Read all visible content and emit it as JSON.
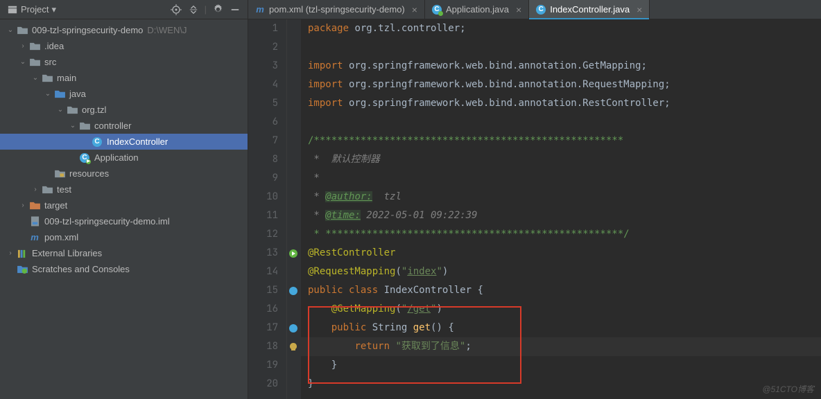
{
  "sidebar": {
    "title": "Project",
    "tree": {
      "root": {
        "label": "009-tzl-springsecurity-demo",
        "hint": "D:\\WEN\\J"
      },
      "idea": ".idea",
      "src": "src",
      "main": "main",
      "java": "java",
      "orgtzl": "org.tzl",
      "controller": "controller",
      "indexcontroller": "IndexController",
      "application": "Application",
      "resources": "resources",
      "test": "test",
      "target": "target",
      "iml": "009-tzl-springsecurity-demo.iml",
      "pom": "pom.xml",
      "extlib": "External Libraries",
      "scratches": "Scratches and Consoles"
    }
  },
  "tabs": [
    {
      "label": "pom.xml (tzl-springsecurity-demo)",
      "icon": "m"
    },
    {
      "label": "Application.java",
      "icon": "c"
    },
    {
      "label": "IndexController.java",
      "icon": "c",
      "active": true
    }
  ],
  "code": {
    "line1": {
      "kw": "package",
      "rest": " org.tzl.controller;"
    },
    "line3": {
      "kw": "import",
      "p1": " org.springframework.web.bind.annotation.",
      "cls": "GetMapping",
      "end": ";"
    },
    "line4": {
      "kw": "import",
      "p1": " org.springframework.web.bind.annotation.",
      "cls": "RequestMapping",
      "end": ";"
    },
    "line5": {
      "kw": "import",
      "p1": " org.springframework.web.bind.annotation.",
      "cls": "RestController",
      "end": ";"
    },
    "line7": "/*****************************************************",
    "line8": " *  默认控制器",
    "line9": " *",
    "line10": {
      "pre": " * ",
      "tag": "@author:",
      "val": "  tzl"
    },
    "line11": {
      "pre": " * ",
      "tag": "@time:",
      "val": " 2022-05-01 09:22:39"
    },
    "line12": " * ***************************************************/",
    "line13": "@RestController",
    "line14": {
      "ann": "@RequestMapping",
      "p": "(",
      "s": "\"",
      "u": "index",
      "s2": "\"",
      "p2": ")"
    },
    "line15": {
      "kw1": "public",
      "kw2": "class",
      "cls": "IndexController",
      "b": " {"
    },
    "line16": {
      "ann": "@GetMapping",
      "p": "(",
      "s": "\"",
      "u": "/get",
      "s2": "\"",
      "p2": ")"
    },
    "line17": {
      "kw": "public",
      "ty": "String",
      "m": "get",
      "r": "() {"
    },
    "line18": {
      "kw": "return",
      "s": " \"获取到了信息\"",
      "e": ";"
    },
    "line19": "    }",
    "line20": "}"
  },
  "watermark": "@51CTO博客"
}
